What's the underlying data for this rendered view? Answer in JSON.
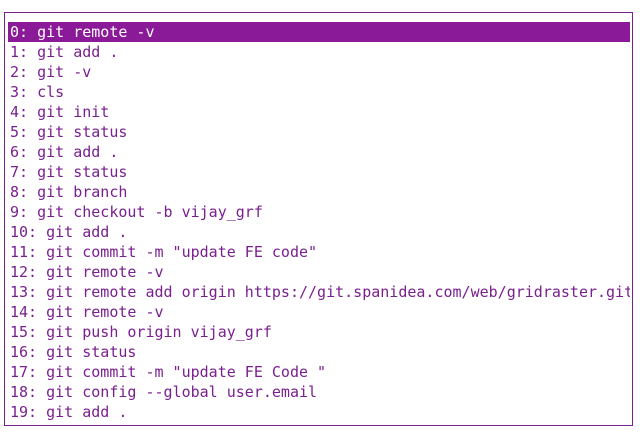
{
  "colors": {
    "text": "#7a1f8f",
    "selection_background": "#8b1a98",
    "selection_text": "#ffffff",
    "background": "#ffffff"
  },
  "history": {
    "selected_index": 0,
    "items": [
      "0: git remote -v",
      "1: git add .",
      "2: git -v",
      "3: cls",
      "4: git init",
      "5: git status",
      "6: git add .",
      "7: git status",
      "8: git branch",
      "9: git checkout -b vijay_grf",
      "10: git add .",
      "11: git commit -m \"update FE code\"",
      "12: git remote -v",
      "13: git remote add origin https://git.spanidea.com/web/gridraster.git",
      "14: git remote -v",
      "15: git push origin vijay_grf",
      "16: git status",
      "17: git commit -m \"update FE Code \"",
      "18: git config --global user.email",
      "19: git add ."
    ]
  }
}
